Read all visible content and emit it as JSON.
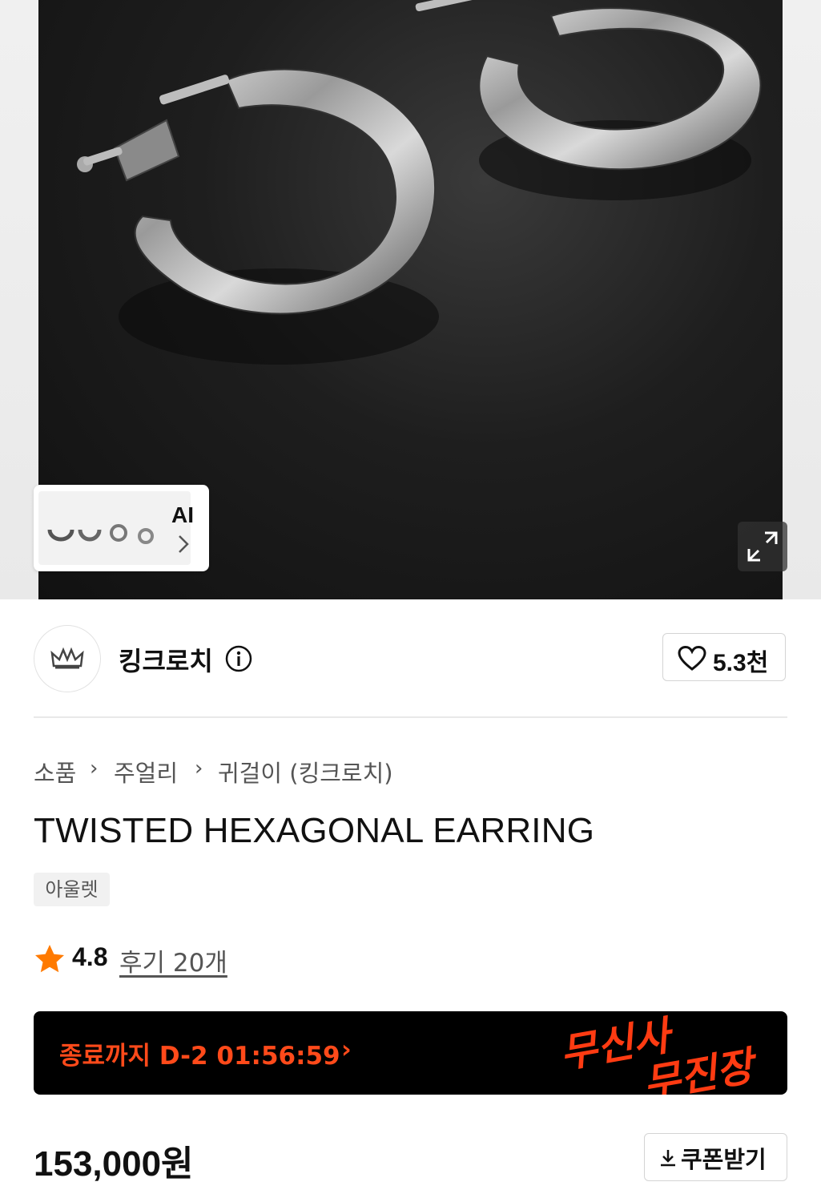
{
  "gallery": {
    "ai_label": "AI",
    "icons": {
      "ai_chevron": "chevron-right-icon",
      "expand": "expand-icon"
    }
  },
  "brand": {
    "name": "킹크로치",
    "like_count": "5.3천",
    "icons": {
      "info": "info-icon",
      "heart": "heart-icon",
      "logo": "crown-icon"
    }
  },
  "breadcrumb": {
    "items": [
      "소품",
      "주얼리",
      "귀걸이 (킹크로치)"
    ],
    "separator": "›"
  },
  "product": {
    "title": "TWISTED HEXAGONAL EARRING",
    "tag": "아울렛",
    "rating": "4.8",
    "reviews_label": "후기 20개",
    "price": "153,000원"
  },
  "promo": {
    "countdown": "종료까지 D-2 01:56:59",
    "chevron": "›",
    "logo_line1": "무신사",
    "logo_line2": "무진장",
    "color": "#ff4a1a"
  },
  "coupon": {
    "label": "쿠폰받기",
    "icon": "download-icon"
  }
}
